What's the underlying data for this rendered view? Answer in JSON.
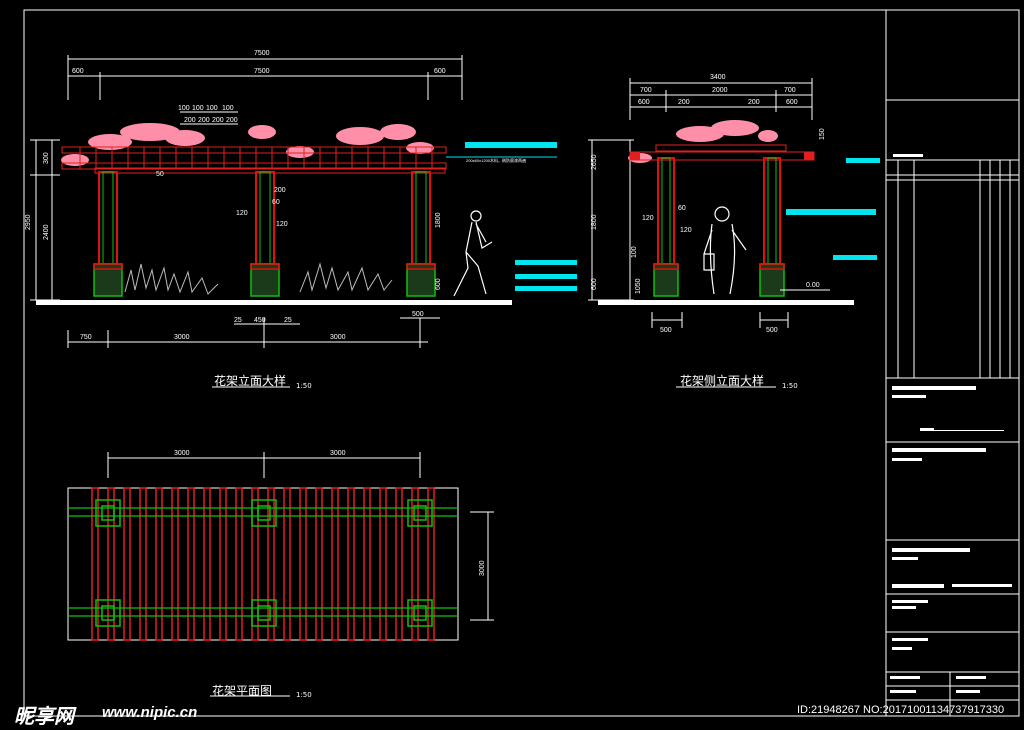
{
  "titles": {
    "front": "花架立面大样",
    "side": "花架侧立面大样",
    "plan": "花架平面图",
    "scale": "1:50"
  },
  "front_dims": {
    "overall": "7500",
    "left_overhang": "600",
    "span": "7500",
    "right_overhang": "600",
    "top_spacing": [
      "100",
      "100",
      "100",
      "100"
    ],
    "top_spacing2": [
      "200",
      "200",
      "200",
      "200"
    ],
    "post_offset": "50",
    "h_total": "2950",
    "h_post": "2400",
    "h_beam": "300",
    "h_1800": "1800",
    "h_600": "600",
    "col_200": "200",
    "col_60": "60",
    "col_120a": "120",
    "col_120b": "120",
    "base_a": "25",
    "base_b": "450",
    "base_c": "25",
    "base_w": "500",
    "bay_left": "750",
    "bay1": "3000",
    "bay2": "3000"
  },
  "side_dims": {
    "overall": "3400",
    "d700a": "700",
    "d2000": "2000",
    "d700b": "700",
    "d600a": "600",
    "d200a": "200",
    "d200b": "200",
    "d600b": "600",
    "d150": "150",
    "d2650": "2650",
    "d1800": "1800",
    "d120": "120",
    "d60": "60",
    "d120b": "120",
    "d100": "100",
    "d600": "600",
    "d1050": "1050",
    "d500a": "500",
    "d500b": "500",
    "level": "0.00"
  },
  "plan_dims": {
    "bay1": "3000",
    "bay2": "3000",
    "width": "3000"
  },
  "annotation": "200x60x1200木料，刷防腐漆两遍",
  "watermark": {
    "logo": "昵享网",
    "url": "www.nipic.cn",
    "id": "ID:21948267 NO:20171001134737917330"
  },
  "colors": {
    "frame": "#ffffff",
    "post_red": "#e01010",
    "post_green": "#10c010",
    "flowers": "#ff8fa8",
    "cyan": "#00e5ee",
    "beam_red": "#e02020"
  }
}
